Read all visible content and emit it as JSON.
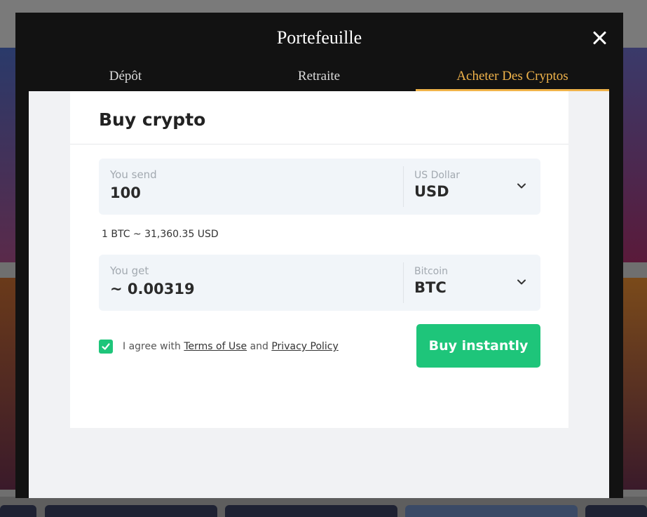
{
  "modal": {
    "title": "Portefeuille"
  },
  "tabs": [
    {
      "label": "Dépôt",
      "active": false
    },
    {
      "label": "Retraite",
      "active": false
    },
    {
      "label": "Acheter Des Cryptos",
      "active": true
    }
  ],
  "widget": {
    "title": "Buy crypto",
    "send": {
      "label": "You send",
      "value": "100",
      "currency_name": "US Dollar",
      "currency_code": "USD"
    },
    "rate": "1 BTC ~ 31,360.35 USD",
    "get": {
      "label": "You get",
      "value": "~ 0.00319",
      "currency_name": "Bitcoin",
      "currency_code": "BTC"
    },
    "agree": {
      "prefix": "I agree with",
      "terms": "Terms of Use",
      "and": "and",
      "privacy": "Privacy Policy",
      "checked": true
    },
    "buy_button": "Buy instantly"
  },
  "colors": {
    "accent_green": "#1ec57a",
    "tab_active": "#f0b34a",
    "modal_bg": "#121212"
  },
  "icons": [
    "close-icon",
    "chevron-down-icon",
    "checkmark-icon"
  ]
}
